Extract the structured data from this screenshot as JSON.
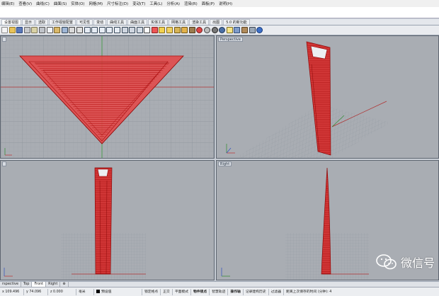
{
  "menubar": [
    "编辑(E)",
    "查看(V)",
    "曲线(C)",
    "曲面(S)",
    "实体(O)",
    "网格(M)",
    "尺寸标注(D)",
    "变动(T)",
    "工具(L)",
    "分析(A)",
    "渲染(R)",
    "面板(P)",
    "说明(H)"
  ],
  "tabs": [
    "设置视图",
    "显示",
    "选取",
    "工作视窗配置",
    "可见性",
    "变动",
    "曲线工具",
    "曲面工具",
    "实体工具",
    "网格工具",
    "渲染工具",
    "出图",
    "5.0 的新功能"
  ],
  "active_tab": 0,
  "viewports": {
    "top": {
      "label": ""
    },
    "perspective": {
      "label": "Perspective"
    },
    "front": {
      "label": ""
    },
    "right": {
      "label": "Right"
    }
  },
  "viewport_tabs": [
    "rspective",
    "Top",
    "Front",
    "Right"
  ],
  "viewport_tab_add": "⊕",
  "active_viewport_tab": 2,
  "status": {
    "x": "x 109.496",
    "y": "y 74.096",
    "z": "z 0.000",
    "unit": "毫米",
    "layer": "预设值",
    "items": [
      "锁定格点",
      "正交",
      "平面模式",
      "物件锁点",
      "智慧轨迹",
      "操作轴",
      "记录建构历史",
      "过滤器",
      "距离上次保存的时间 (分钟): 4"
    ]
  },
  "watermark": "微信号",
  "colors": {
    "accent": "#e02020",
    "object": "#d81c1c"
  }
}
